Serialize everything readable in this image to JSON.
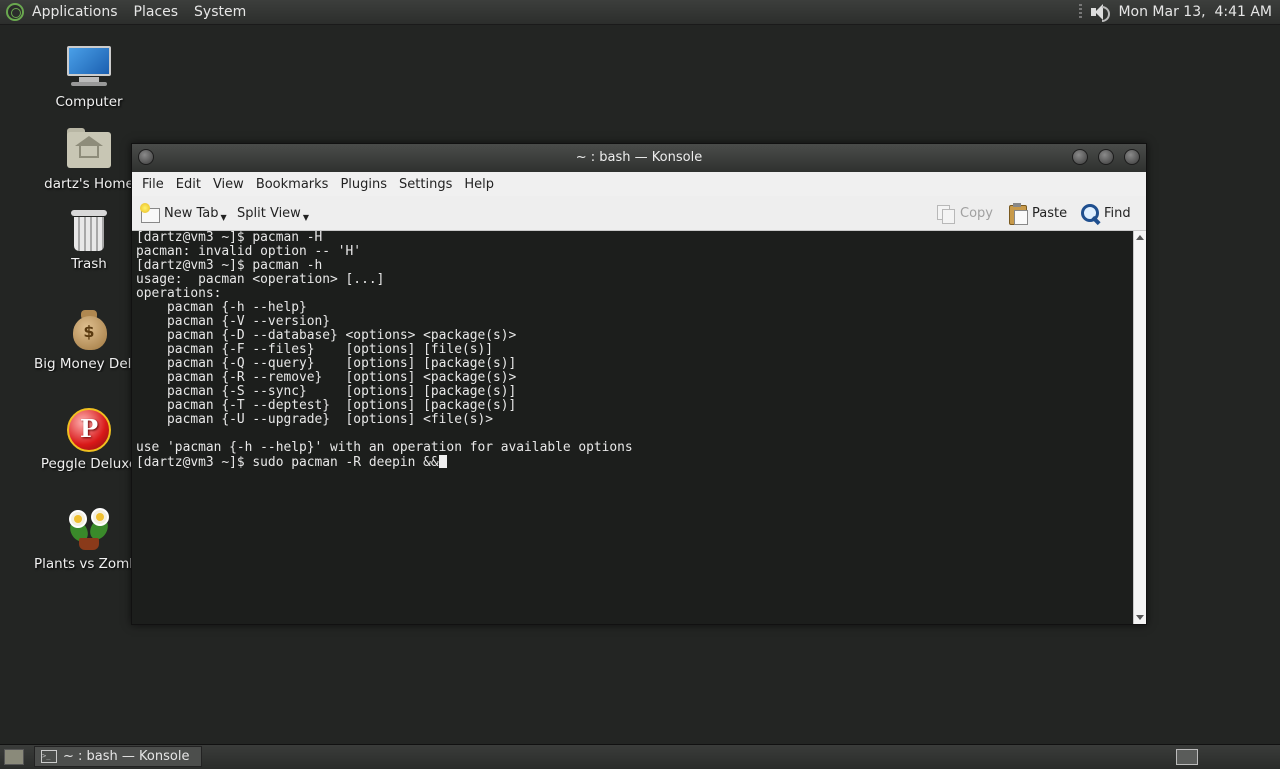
{
  "top_panel": {
    "menus": [
      "Applications",
      "Places",
      "System"
    ],
    "clock": "Mon Mar 13,  4:41 AM"
  },
  "desktop_icons": [
    {
      "label": "Computer",
      "icon": "computer-icon"
    },
    {
      "label": "dartz's Home",
      "icon": "home-folder-icon"
    },
    {
      "label": "Trash",
      "icon": "trash-icon"
    },
    {
      "label": "Big Money Deluxe",
      "icon": "money-bag-icon"
    },
    {
      "label": "Peggle Deluxe",
      "icon": "peggle-icon"
    },
    {
      "label": "Plants vs Zombies",
      "icon": "plants-icon"
    }
  ],
  "window": {
    "title": "~ : bash — Konsole",
    "menus": [
      "File",
      "Edit",
      "View",
      "Bookmarks",
      "Plugins",
      "Settings",
      "Help"
    ],
    "toolbar": {
      "new_tab": "New Tab",
      "split_view": "Split View",
      "copy": "Copy",
      "paste": "Paste",
      "find": "Find"
    },
    "terminal_lines": [
      "[dartz@vm3 ~]$ pacman -H",
      "pacman: invalid option -- 'H'",
      "[dartz@vm3 ~]$ pacman -h",
      "usage:  pacman <operation> [...]",
      "operations:",
      "    pacman {-h --help}",
      "    pacman {-V --version}",
      "    pacman {-D --database} <options> <package(s)>",
      "    pacman {-F --files}    [options] [file(s)]",
      "    pacman {-Q --query}    [options] [package(s)]",
      "    pacman {-R --remove}   [options] <package(s)>",
      "    pacman {-S --sync}     [options] [package(s)]",
      "    pacman {-T --deptest}  [options] [package(s)]",
      "    pacman {-U --upgrade}  [options] <file(s)>",
      "",
      "use 'pacman {-h --help}' with an operation for available options"
    ],
    "prompt_line": "[dartz@vm3 ~]$ sudo pacman -R deepin &&"
  },
  "taskbar": {
    "task_label": "~ : bash — Konsole"
  },
  "colors": {
    "desktop": "#232523",
    "terminal_bg": "#1c1e1c",
    "terminal_fg": "#e8e8e8"
  }
}
